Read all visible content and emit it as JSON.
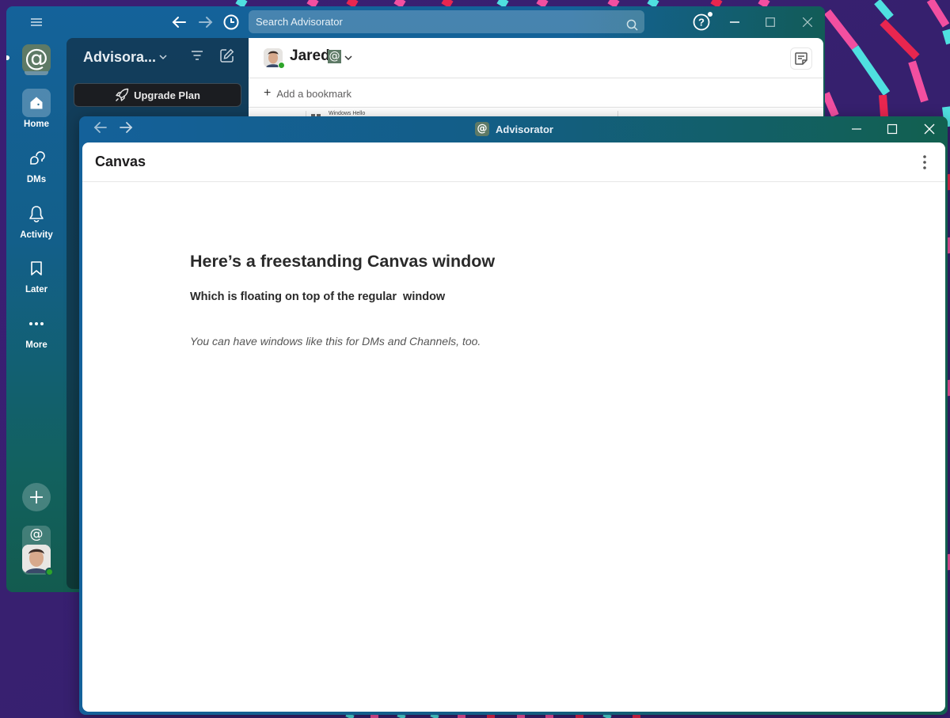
{
  "colors": {
    "desktop_bg": "#3a2070",
    "stripe_cyan": "#4fe0e0",
    "stripe_pink": "#f24fa0",
    "stripe_red": "#e8264f",
    "workspace_logo_bg": "#5e7a66",
    "presence_online": "#2ea52a"
  },
  "main_window": {
    "search": {
      "placeholder": "Search Advisorator"
    },
    "rail": {
      "workspace_logo": "@",
      "items": [
        {
          "label": "Home",
          "icon": "home-icon",
          "active": true
        },
        {
          "label": "DMs",
          "icon": "dms-icon",
          "active": false
        },
        {
          "label": "Activity",
          "icon": "bell-icon",
          "active": false
        },
        {
          "label": "Later",
          "icon": "bookmark-icon",
          "active": false
        },
        {
          "label": "More",
          "icon": "more-icon",
          "active": false
        }
      ],
      "add_button": "+",
      "profile_workspace": "@"
    },
    "sidebar": {
      "workspace_name": "Advisora...",
      "upgrade_label": "Upgrade Plan"
    },
    "channel": {
      "name": "Jared",
      "badge": "@",
      "bookmark_label": "Add a bookmark",
      "bookmark_plus": "+",
      "peek_text": "Windows Hello"
    }
  },
  "canvas_window": {
    "title": "Advisorator",
    "title_logo": "@",
    "heading": "Canvas",
    "document": {
      "h1": "Here’s a freestanding Canvas window",
      "h3": "Which is floating on top of the regular  window",
      "italic": "You can have windows like this for DMs and Channels, too."
    }
  }
}
